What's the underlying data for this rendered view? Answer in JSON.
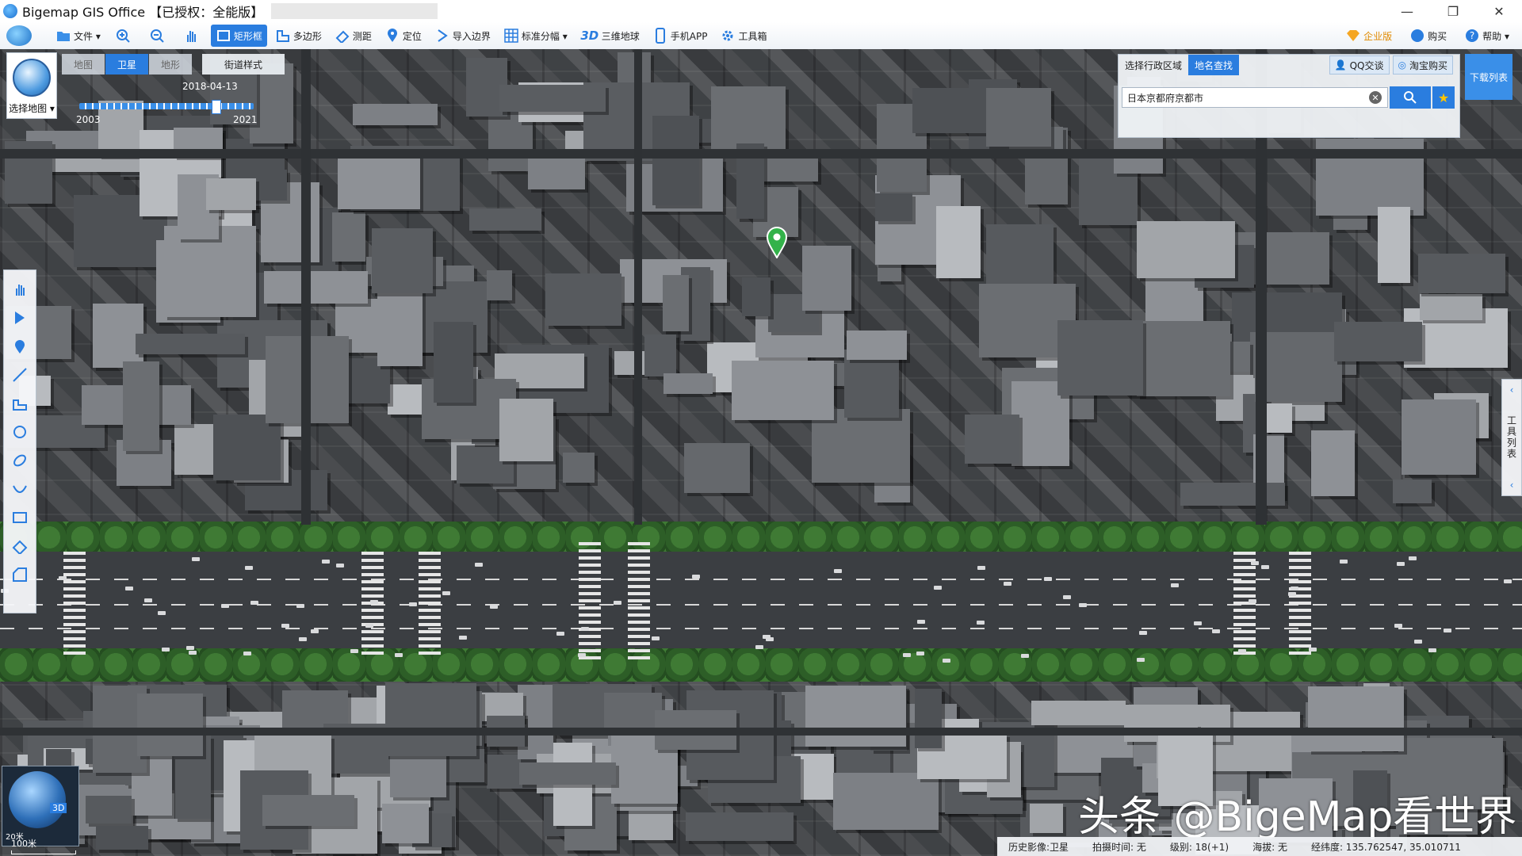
{
  "window": {
    "title": "Bigemap GIS Office 【已授权：全能版】",
    "controls": [
      "—",
      "❐",
      "✕"
    ]
  },
  "toolbar": {
    "items": [
      {
        "label": "文件 ▾",
        "icon": "folder-icon"
      },
      {
        "label": "",
        "icon": "zoom-in-icon"
      },
      {
        "label": "",
        "icon": "zoom-out-icon"
      },
      {
        "label": "",
        "icon": "hand-icon"
      },
      {
        "label": "矩形框",
        "icon": "rectangle-icon",
        "active": true
      },
      {
        "label": "多边形",
        "icon": "polygon-icon"
      },
      {
        "label": "测距",
        "icon": "ruler-icon"
      },
      {
        "label": "定位",
        "icon": "pin-icon"
      },
      {
        "label": "导入边界",
        "icon": "import-icon"
      },
      {
        "label": "标准分幅 ▾",
        "icon": "grid-icon"
      },
      {
        "label": "三维地球",
        "icon": "3d-icon"
      },
      {
        "label": "手机APP",
        "icon": "phone-icon"
      },
      {
        "label": "工具箱",
        "icon": "gear-icon"
      }
    ],
    "enterprise": "企业版",
    "buy": "购买",
    "help": "帮助 ▾"
  },
  "map_select": {
    "label": "选择地图 ▾"
  },
  "map_types": {
    "map": "地图",
    "satellite": "卫星",
    "terrain": "地形",
    "street_style": "街道样式",
    "active": "卫星"
  },
  "timeline": {
    "date": "2018-04-13",
    "start_year": "2003",
    "end_year": "2021",
    "position": 0.78
  },
  "search": {
    "tab_region": "选择行政区域",
    "tab_place": "地名查找",
    "qq": "QQ交谈",
    "taobao": "淘宝购买",
    "value": "日本京都府京都市"
  },
  "download_list": "下载列表",
  "right_panel": {
    "label": "工具列表"
  },
  "minimap": {
    "badge": "3D",
    "scale_label": "20米"
  },
  "scale_bar": {
    "label": "100米"
  },
  "watermark": "头条 @BigeMap看世界",
  "status": {
    "history": "历史影像:卫星",
    "shot_time": "拍摄时间: 无",
    "level": "级别: 18(+1)",
    "altitude": "海拔: 无",
    "lonlat": "经纬度: 135.762547, 35.010711"
  },
  "colors": {
    "accent": "#2a7ddf",
    "marker": "#33b24a",
    "tree": "#3f7a34"
  }
}
